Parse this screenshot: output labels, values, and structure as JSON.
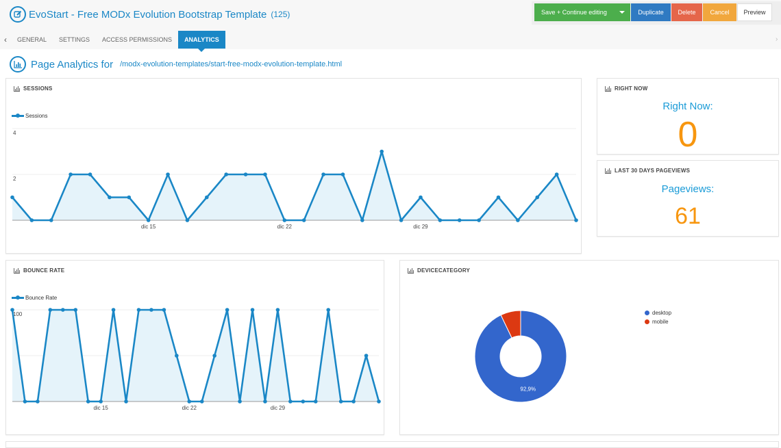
{
  "header": {
    "title": "EvoStart - Free MODx Evolution Bootstrap Template",
    "doc_id": "(125)",
    "icon": "edit-icon"
  },
  "actions": {
    "save_label": "Save + Continue editing",
    "duplicate_label": "Duplicate",
    "delete_label": "Delete",
    "cancel_label": "Cancel",
    "preview_label": "Preview",
    "colors": {
      "save": "#4cae4c",
      "duplicate": "#2f7ac2",
      "delete": "#e5664a",
      "cancel": "#f1a73d"
    }
  },
  "tabs": [
    {
      "label": "GENERAL",
      "active": false
    },
    {
      "label": "SETTINGS",
      "active": false
    },
    {
      "label": "ACCESS PERMISSIONS",
      "active": false
    },
    {
      "label": "ANALYTICS",
      "active": true
    }
  ],
  "tab_nav": {
    "prev": "‹",
    "next": "›"
  },
  "page": {
    "title": "Page Analytics for",
    "path": "/modx-evolution-templates/start-free-modx-evolution-template.html",
    "icon": "analytics-icon"
  },
  "panels": {
    "sessions": {
      "heading": "SESSIONS"
    },
    "right_now": {
      "heading": "RIGHT NOW",
      "label": "Right Now:",
      "value": "0"
    },
    "pageviews": {
      "heading": "LAST 30 DAYS PAGEVIEWS",
      "label": "Pageviews:",
      "value": "61"
    },
    "bounce_rate": {
      "heading": "BOUNCE RATE"
    },
    "device": {
      "heading": "DEVICECATEGORY"
    }
  },
  "accent_color": "#1a87c6",
  "value_color": "#f7960f",
  "chart_data": [
    {
      "type": "area",
      "title": "Sessions",
      "legend": [
        "Sessions"
      ],
      "legend_position": "top-left",
      "x_tick_labels": [
        {
          "index": 7,
          "label": "dic 15"
        },
        {
          "index": 14,
          "label": "dic 22"
        },
        {
          "index": 21,
          "label": "dic 29"
        }
      ],
      "y_ticks": [
        2,
        4
      ],
      "ylim": [
        0,
        4
      ],
      "grid": true,
      "series": [
        {
          "name": "Sessions",
          "color": "#1a87c6",
          "values": [
            1,
            0,
            0,
            2,
            2,
            1,
            1,
            0,
            2,
            0,
            1,
            2,
            2,
            2,
            0,
            0,
            2,
            2,
            0,
            3,
            0,
            1,
            0,
            0,
            0,
            1,
            0,
            1,
            2,
            0
          ]
        }
      ]
    },
    {
      "type": "area",
      "title": "Bounce Rate",
      "legend": [
        "Bounce Rate"
      ],
      "legend_position": "top-left",
      "x_tick_labels": [
        {
          "index": 7,
          "label": "dic 15"
        },
        {
          "index": 14,
          "label": "dic 22"
        },
        {
          "index": 21,
          "label": "dic 29"
        }
      ],
      "y_ticks": [
        50,
        100
      ],
      "ylim": [
        0,
        100
      ],
      "grid": true,
      "series": [
        {
          "name": "Bounce Rate",
          "color": "#1a87c6",
          "values": [
            100,
            0,
            0,
            100,
            100,
            100,
            0,
            0,
            100,
            0,
            100,
            100,
            100,
            50,
            0,
            0,
            50,
            100,
            0,
            100,
            0,
            100,
            0,
            0,
            0,
            100,
            0,
            0,
            50,
            0
          ]
        }
      ]
    },
    {
      "type": "pie",
      "title": "deviceCategory",
      "donut": true,
      "legend_position": "right",
      "slices": [
        {
          "label": "desktop",
          "value": 92.9,
          "display": "92,9%",
          "color": "#3366cc"
        },
        {
          "label": "mobile",
          "value": 7.1,
          "display": "",
          "color": "#dc3912"
        }
      ]
    }
  ]
}
